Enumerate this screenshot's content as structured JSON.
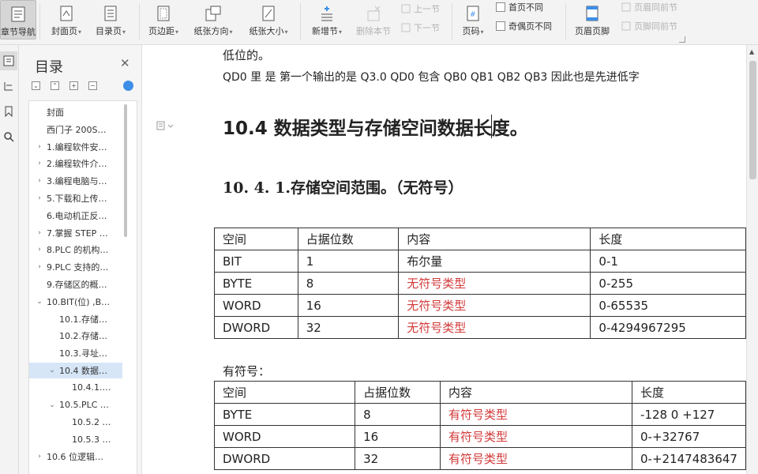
{
  "ribbon": {
    "chapter_nav": "章节导航",
    "cover": "封面页",
    "toc_page": "目录页",
    "margins": "页边距",
    "orientation": "纸张方向",
    "paper_size": "纸张大小",
    "new_section": "新增节",
    "delete_section": "删除本节",
    "prev_section": "上一节",
    "next_section": "下一节",
    "page_number": "页码",
    "first_page_diff": "首页不同",
    "odd_even_diff": "奇偶页不同",
    "header_footer": "页眉页脚",
    "header_prev": "页眉同前节",
    "footer_prev": "页脚同前节"
  },
  "nav": {
    "title": "目录",
    "items": [
      {
        "label": "封面",
        "level": 0,
        "expand": ""
      },
      {
        "label": "西门子 200S…",
        "level": 0,
        "expand": ""
      },
      {
        "label": "1.编程软件安…",
        "level": 0,
        "expand": "›"
      },
      {
        "label": "2.编程软件介…",
        "level": 0,
        "expand": "›"
      },
      {
        "label": "3.编程电脑与…",
        "level": 0,
        "expand": "›"
      },
      {
        "label": "5.下载和上传…",
        "level": 0,
        "expand": "›"
      },
      {
        "label": "6.电动机正反…",
        "level": 0,
        "expand": ""
      },
      {
        "label": "7.掌握 STEP …",
        "level": 0,
        "expand": "›"
      },
      {
        "label": "8.PLC 的机构…",
        "level": 0,
        "expand": "›"
      },
      {
        "label": "9.PLC 支持的…",
        "level": 0,
        "expand": "›"
      },
      {
        "label": "9.存储区的概…",
        "level": 0,
        "expand": ""
      },
      {
        "label": "10.BIT(位) ,B…",
        "level": 0,
        "expand": "⌄"
      },
      {
        "label": "10.1.存储…",
        "level": 1,
        "expand": ""
      },
      {
        "label": "10.2.存储…",
        "level": 1,
        "expand": ""
      },
      {
        "label": "10.3.寻址…",
        "level": 1,
        "expand": ""
      },
      {
        "label": "10.4 数据…",
        "level": 1,
        "expand": "⌄",
        "selected": true
      },
      {
        "label": "10.4.1.…",
        "level": 2,
        "expand": ""
      },
      {
        "label": "10.5.PLC …",
        "level": 1,
        "expand": "⌄"
      },
      {
        "label": "10.5.2 …",
        "level": 2,
        "expand": ""
      },
      {
        "label": "10.5.3 …",
        "level": 2,
        "expand": ""
      },
      {
        "label": "10.6 位逻辑…",
        "level": 0,
        "expand": "›"
      }
    ]
  },
  "doc": {
    "line_top": "低位的。",
    "line_qd": "QD0    里   是   第一个输出的是   Q3.0     QD0 包含   QB0 QB1 QB2 QB3   因此也是先进低字",
    "heading": "10.4 数据类型与存储空间数据长度。",
    "subheading": "10. 4. 1.存储空间范围。（无符号）",
    "table1": {
      "headers": [
        "空间",
        "占据位数",
        "内容",
        "长度"
      ],
      "rows": [
        [
          "BIT",
          "1",
          "布尔量",
          "0-1"
        ],
        [
          "BYTE",
          "8",
          "无符号类型",
          "0-255"
        ],
        [
          "WORD",
          "16",
          "无符号类型",
          "0-65535"
        ],
        [
          "DWORD",
          "32",
          "无符号类型",
          "0-4294967295"
        ]
      ]
    },
    "signed_label": "有符号：",
    "table2": {
      "headers": [
        "空间",
        "占据位数",
        "内容",
        "长度"
      ],
      "rows": [
        [
          "BYTE",
          "8",
          "有符号类型",
          "-128      0      +127"
        ],
        [
          "WORD",
          "16",
          "有符号类型",
          "0-+32767"
        ],
        [
          "DWORD",
          "32",
          "有符号类型",
          "0-+2147483647"
        ]
      ]
    }
  },
  "colors": {
    "accent_red": "#d23a3a",
    "selection": "#d6e6f7",
    "sync_button": "#3e8ee8"
  }
}
